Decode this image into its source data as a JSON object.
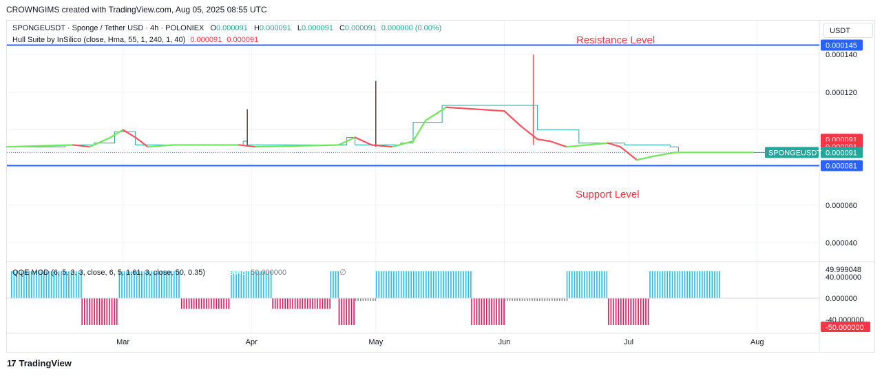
{
  "header": {
    "credit": "CROWNGIMS created with TradingView.com, Aug 05, 2025 08:55 UTC"
  },
  "footer": {
    "logo_text": "TradingView",
    "logo_mark": "17"
  },
  "legend": {
    "symbol_line": "SPONGEUSDT · Sponge / Tether USD · 4h · POLONIEX",
    "o_label": "O",
    "o_value": "0.000091",
    "h_label": "H",
    "h_value": "0.000091",
    "l_label": "L",
    "l_value": "0.000091",
    "c_label": "C",
    "c_value": "0.000091",
    "change": "0.000000 (0.00%)",
    "indicator": "Hull Suite by InSilico (close, Hma, 55, 1, 240, 1, 40)",
    "indicator_v1": "0.000091",
    "indicator_v2": "0.000091",
    "qqe_name": "QQE MOD (6, 5, 3, 3, close, 6, 5, 1.61, 3, close, 50, 0.35)",
    "qqe_v1": "49.999048",
    "qqe_v2": "50.000000",
    "qqe_v3": "∅"
  },
  "price_axis": {
    "unit": "USDT"
  },
  "annotations": {
    "resistance": "Resistance Level",
    "support": "Support Level"
  },
  "colors": {
    "level_line": "#2962ff",
    "hull_up": "#6fe85a",
    "hull_down": "#f7525f",
    "candle": "#26a69a",
    "wick": "#5d4037",
    "qqe_up": "#1ebff0",
    "qqe_down": "#f0115a",
    "qqe_neutral": "#888888",
    "price_label_red": "#f23645",
    "price_label_teal": "#26a69a",
    "price_label_blue": "#2962ff"
  },
  "chart_data": [
    {
      "type": "line",
      "title": "SPONGEUSDT · Sponge / Tether USD · 4h · POLONIEX",
      "ylim": [
        3e-05,
        0.000158
      ],
      "y_ticks": [
        "0.000040",
        "0.000060",
        "0.000120",
        "0.000140"
      ],
      "x_ticks": [
        "Mar",
        "Apr",
        "May",
        "Jun",
        "Jul",
        "Aug"
      ],
      "x_tick_days": [
        28,
        59,
        89,
        120,
        150,
        181
      ],
      "x_range_days": [
        0,
        196
      ],
      "horizontal_levels": [
        {
          "name": "Resistance Level",
          "value": 0.000145,
          "label": "0.000145"
        },
        {
          "name": "Support Level",
          "value": 8.1e-05,
          "label": "0.000081"
        }
      ],
      "price_labels": [
        {
          "text": "0.000091",
          "value": 9.5e-05,
          "kind": "red"
        },
        {
          "text": "0.000091",
          "value": 9.1e-05,
          "kind": "red"
        },
        {
          "text": "0.000091",
          "value": 8.8e-05,
          "kind": "teal",
          "tag": "SPONGEUSDT"
        }
      ],
      "last_price": 9.1e-05,
      "price_steps": [
        [
          0,
          9.1e-05
        ],
        [
          14,
          9.2e-05
        ],
        [
          21,
          9.3e-05
        ],
        [
          26,
          9.9e-05
        ],
        [
          31,
          9.2e-05
        ],
        [
          56,
          9.2e-05
        ],
        [
          57,
          9.4e-05
        ],
        [
          58,
          9.2e-05
        ],
        [
          81,
          9.2e-05
        ],
        [
          82,
          9.6e-05
        ],
        [
          84,
          9.2e-05
        ],
        [
          95,
          9.3e-05
        ],
        [
          98,
          0.000104
        ],
        [
          105,
          0.000113
        ],
        [
          118,
          0.000113
        ],
        [
          128,
          0.0001
        ],
        [
          138,
          9.3e-05
        ],
        [
          149,
          9.2e-05
        ],
        [
          160,
          9.1e-05
        ],
        [
          162,
          8.8e-05
        ],
        [
          180,
          8.8e-05
        ]
      ],
      "wicks": [
        {
          "x": 58,
          "high": 0.000111,
          "low": 9.2e-05
        },
        {
          "x": 89,
          "high": 0.000126,
          "low": 9.1e-05
        },
        {
          "x": 127,
          "high": 0.00014,
          "low": 9.2e-05
        }
      ],
      "hull_suite": [
        [
          0,
          9.1e-05
        ],
        [
          16,
          9.2e-05
        ],
        [
          20,
          9.1e-05
        ],
        [
          25,
          9.6e-05
        ],
        [
          28,
          0.0001
        ],
        [
          31,
          9.6e-05
        ],
        [
          34,
          9.1e-05
        ],
        [
          40,
          9.2e-05
        ],
        [
          56,
          9.2e-05
        ],
        [
          60,
          9.1e-05
        ],
        [
          80,
          9.2e-05
        ],
        [
          84,
          9.6e-05
        ],
        [
          88,
          9.2e-05
        ],
        [
          93,
          9.1e-05
        ],
        [
          98,
          9.4e-05
        ],
        [
          101,
          0.000105
        ],
        [
          106,
          0.000112
        ],
        [
          113,
          0.000111
        ],
        [
          120,
          0.00011
        ],
        [
          124,
          0.000102
        ],
        [
          128,
          9.5e-05
        ],
        [
          131,
          9.4e-05
        ],
        [
          135,
          9.1e-05
        ],
        [
          140,
          9.2e-05
        ],
        [
          145,
          9.3e-05
        ],
        [
          148,
          9.1e-05
        ],
        [
          152,
          8.4e-05
        ],
        [
          156,
          8.6e-05
        ],
        [
          161,
          8.8e-05
        ],
        [
          180,
          8.8e-05
        ]
      ]
    },
    {
      "type": "bar",
      "title": "QQE MOD (6, 5, 3, 3, close, 6, 5, 1.61, 3, close, 50, 0.35)",
      "ylim": [
        -50,
        50
      ],
      "y_ticks": [
        "40.000000",
        "0.000000",
        "-40.000000"
      ],
      "labels": [
        "49.999048",
        "-50.000000"
      ],
      "segments": [
        {
          "from": 1,
          "to": 18,
          "value": 50,
          "color": "up"
        },
        {
          "from": 18,
          "to": 27,
          "value": -50,
          "color": "down"
        },
        {
          "from": 27,
          "to": 42,
          "value": 50,
          "color": "up"
        },
        {
          "from": 42,
          "to": 54,
          "value": -20,
          "color": "down"
        },
        {
          "from": 54,
          "to": 64,
          "value": 50,
          "color": "up"
        },
        {
          "from": 64,
          "to": 78,
          "value": -20,
          "color": "down"
        },
        {
          "from": 78,
          "to": 80,
          "value": 50,
          "color": "up"
        },
        {
          "from": 80,
          "to": 84,
          "value": -50,
          "color": "down"
        },
        {
          "from": 84,
          "to": 89,
          "value": -5,
          "color": "neutral"
        },
        {
          "from": 89,
          "to": 98,
          "value": 50,
          "color": "up"
        },
        {
          "from": 98,
          "to": 112,
          "value": 50,
          "color": "up"
        },
        {
          "from": 112,
          "to": 120,
          "value": -50,
          "color": "down"
        },
        {
          "from": 120,
          "to": 135,
          "value": -5,
          "color": "neutral"
        },
        {
          "from": 135,
          "to": 145,
          "value": 50,
          "color": "up"
        },
        {
          "from": 145,
          "to": 155,
          "value": -50,
          "color": "down"
        },
        {
          "from": 155,
          "to": 172,
          "value": 50,
          "color": "up"
        }
      ]
    }
  ]
}
